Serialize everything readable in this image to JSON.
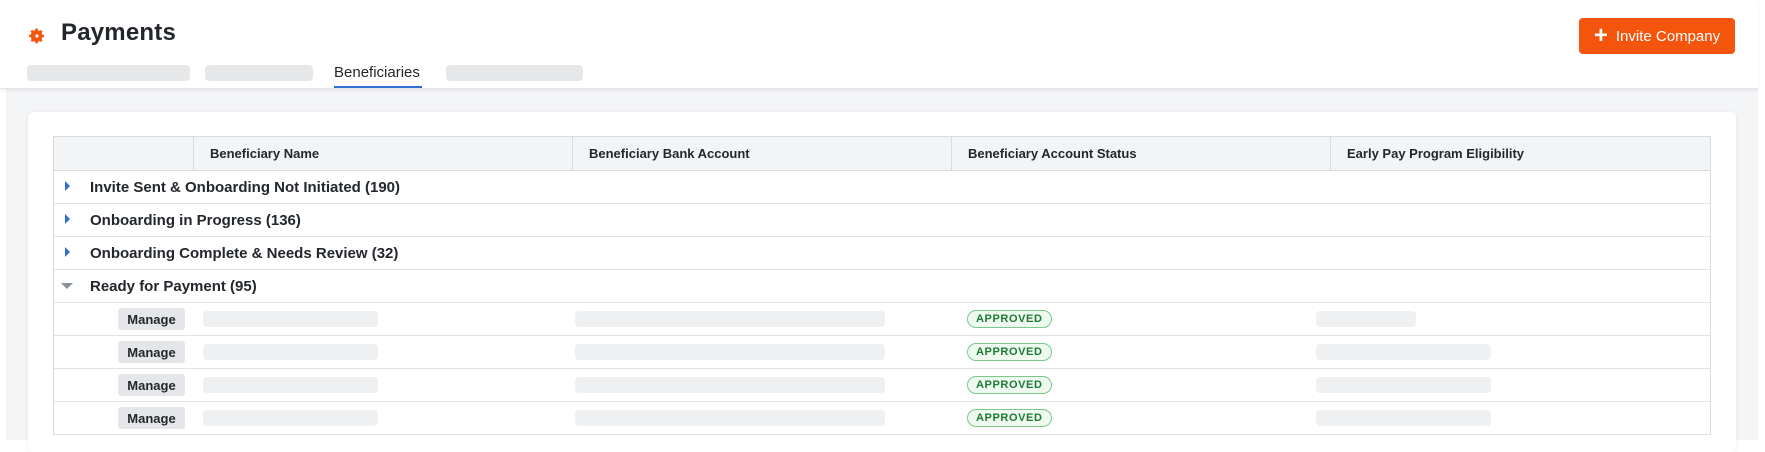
{
  "header": {
    "title": "Payments",
    "invite_button": "Invite Company",
    "active_tab": "Beneficiaries",
    "brand_color": "#f4540c",
    "accent_color": "#2f6fd1"
  },
  "table": {
    "columns": [
      "Beneficiary Name",
      "Beneficiary Bank Account",
      "Beneficiary Account Status",
      "Early Pay Program Eligibility"
    ],
    "groups": [
      {
        "label": "Invite Sent & Onboarding Not Initiated (190)",
        "expanded": false
      },
      {
        "label": "Onboarding in Progress (136)",
        "expanded": false
      },
      {
        "label": "Onboarding Complete & Needs Review (32)",
        "expanded": false
      },
      {
        "label": "Ready for Payment (95)",
        "expanded": true
      }
    ],
    "rows": [
      {
        "action": "Manage",
        "status": "APPROVED"
      },
      {
        "action": "Manage",
        "status": "APPROVED"
      },
      {
        "action": "Manage",
        "status": "APPROVED"
      },
      {
        "action": "Manage",
        "status": "APPROVED"
      }
    ]
  }
}
